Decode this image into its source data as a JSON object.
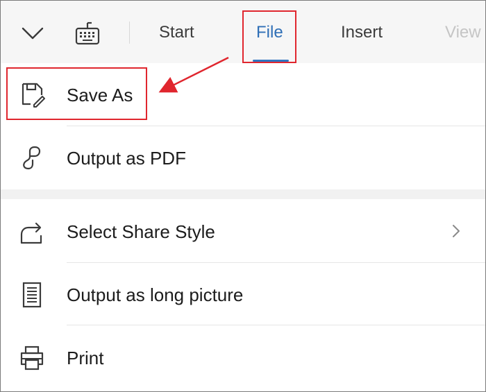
{
  "toolbar": {
    "collapse_icon": "chevron-down-icon",
    "keyboard_icon": "keyboard-icon",
    "tabs": [
      {
        "label": "Start",
        "active": false
      },
      {
        "label": "File",
        "active": true
      },
      {
        "label": "Insert",
        "active": false
      },
      {
        "label": "View",
        "active": false
      }
    ]
  },
  "menu": {
    "items": [
      {
        "label": "Save As",
        "icon": "save-as-icon",
        "has_submenu": false
      },
      {
        "label": "Output as PDF",
        "icon": "pdf-icon",
        "has_submenu": false
      },
      {
        "label": "Select Share Style",
        "icon": "share-icon",
        "has_submenu": true
      },
      {
        "label": "Output as long picture",
        "icon": "long-picture-icon",
        "has_submenu": false
      },
      {
        "label": "Print",
        "icon": "printer-icon",
        "has_submenu": false
      }
    ]
  },
  "annotations": {
    "highlight_color": "#e0262e",
    "highlighted": [
      "File",
      "Save As"
    ]
  },
  "colors": {
    "accent": "#2f74c0",
    "annotation": "#e0262e",
    "toolbar_bg": "#f6f6f6"
  }
}
